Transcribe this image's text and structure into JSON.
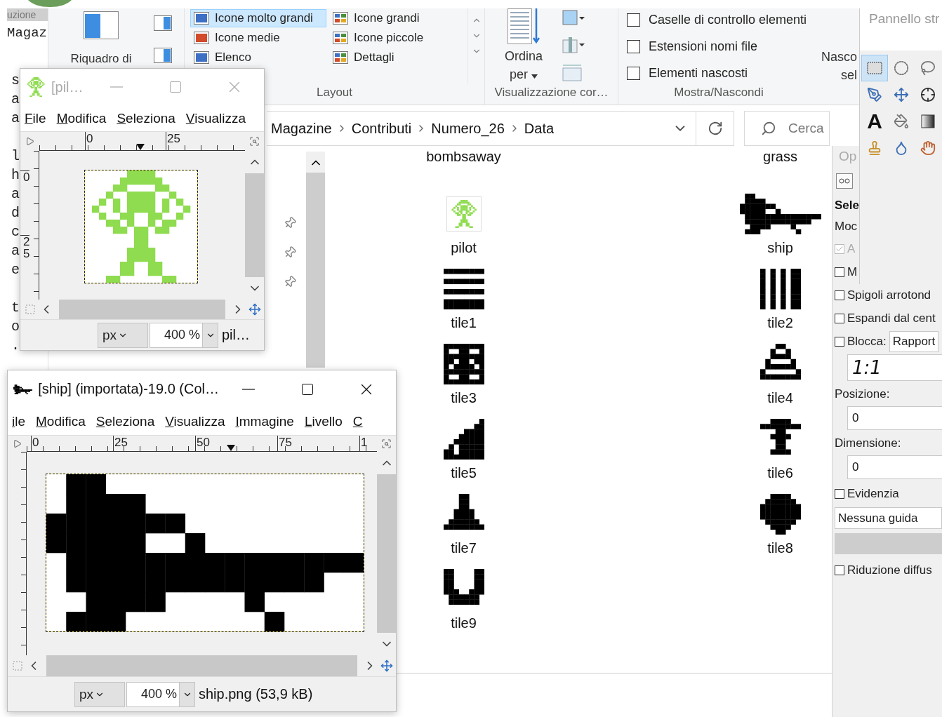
{
  "editor": {
    "header": "uzione",
    "first_line": "Magaz",
    "paragraphs": [
      [
        "s",
        "a",
        "a"
      ],
      [
        "l",
        "h",
        "a",
        "d",
        "c",
        "a",
        "e"
      ],
      [
        "t",
        "o",
        "."
      ]
    ]
  },
  "explorer": {
    "ribbon": {
      "panes": {
        "label": "Riquadro di"
      },
      "layout": {
        "items": [
          {
            "label": "Icone molto grandi",
            "selected": true
          },
          {
            "label": "Icone grandi",
            "selected": false
          },
          {
            "label": "Icone medie",
            "selected": false
          },
          {
            "label": "Icone piccole",
            "selected": false
          },
          {
            "label": "Elenco",
            "selected": false
          },
          {
            "label": "Dettagli",
            "selected": false
          }
        ],
        "group_label": "Layout"
      },
      "current_view": {
        "sort_button": "Ordina per",
        "group_label": "Visualizzazione cor…"
      },
      "show_hide": {
        "options": [
          {
            "label": "Caselle di controllo elementi",
            "checked": false
          },
          {
            "label": "Estensioni nomi file",
            "checked": false
          },
          {
            "label": "Elementi nascosti",
            "checked": false
          }
        ],
        "hide_button": [
          "Nasco",
          "sel"
        ],
        "group_label": "Mostra/Nascondi"
      }
    },
    "address": {
      "path": [
        "Magazine",
        "Contributi",
        "Numero_26",
        "Data"
      ],
      "search": {
        "placeholder": "Cerca"
      }
    },
    "files": {
      "top_labels": [
        "bombsaway",
        "grass"
      ],
      "items": [
        {
          "name": "pilot"
        },
        {
          "name": "ship"
        },
        {
          "name": "tile1"
        },
        {
          "name": "tile2"
        },
        {
          "name": "tile3"
        },
        {
          "name": "tile4"
        },
        {
          "name": "tile5"
        },
        {
          "name": "tile6"
        },
        {
          "name": "tile7"
        },
        {
          "name": "tile8"
        },
        {
          "name": "tile9"
        }
      ]
    }
  },
  "pilot_window": {
    "title": "[pil…",
    "active": false,
    "menu": [
      "File",
      "Modifica",
      "Seleziona",
      "Visualizza"
    ],
    "ruler_h_labels": [
      "0",
      "25"
    ],
    "ruler_v_labels": [
      "0",
      "25"
    ],
    "unit": "px",
    "zoom": "400 %",
    "status": "pil…"
  },
  "ship_window": {
    "title": "[ship] (importata)-19.0 (Col…",
    "active": true,
    "menu": [
      "ile",
      "Modifica",
      "Seleziona",
      "Visualizza",
      "Immagine",
      "Livello",
      "C"
    ],
    "ruler_h_labels": [
      "0",
      "25",
      "50",
      "75",
      "1"
    ],
    "unit": "px",
    "zoom": "400 %",
    "status": "ship.png (53,9 kB)"
  },
  "toolbox": {
    "title": "Pannello str",
    "tools": [
      {
        "selected": true
      },
      {
        "selected": false
      },
      {
        "selected": false
      },
      {
        "selected": false
      },
      {
        "selected": false
      },
      {
        "selected": false
      },
      {
        "selected": false,
        "glyph": "A"
      },
      {
        "selected": false
      },
      {
        "selected": false
      },
      {
        "selected": false
      },
      {
        "selected": false
      },
      {
        "selected": false
      }
    ]
  },
  "tool_options": {
    "tab": "Op",
    "rows": [
      {
        "kind": "heading",
        "text": "Sele"
      },
      {
        "kind": "label",
        "text": "Moc"
      },
      {
        "kind": "check",
        "label": "A",
        "checked": true,
        "disabled": true
      },
      {
        "kind": "check",
        "label": "M",
        "checked": false,
        "disabled": false
      },
      {
        "kind": "check",
        "label": "Spigoli arrotond",
        "checked": false,
        "disabled": false
      },
      {
        "kind": "check",
        "label": "Espandi dal cent",
        "checked": false,
        "disabled": false
      },
      {
        "kind": "check_select",
        "label": "Blocca:",
        "checked": false,
        "value": "Rapport"
      },
      {
        "kind": "ratio_field",
        "value": "1:1"
      },
      {
        "kind": "label",
        "text": "Posizione:"
      },
      {
        "kind": "field",
        "value": "0"
      },
      {
        "kind": "label",
        "text": "Dimensione:"
      },
      {
        "kind": "field",
        "value": "0"
      },
      {
        "kind": "check",
        "label": "Evidenzia",
        "checked": false,
        "disabled": false
      },
      {
        "kind": "select",
        "value": "Nessuna guida"
      },
      {
        "kind": "bar"
      },
      {
        "kind": "check",
        "label": "Riduzione diffus",
        "checked": false,
        "disabled": false
      }
    ]
  }
}
